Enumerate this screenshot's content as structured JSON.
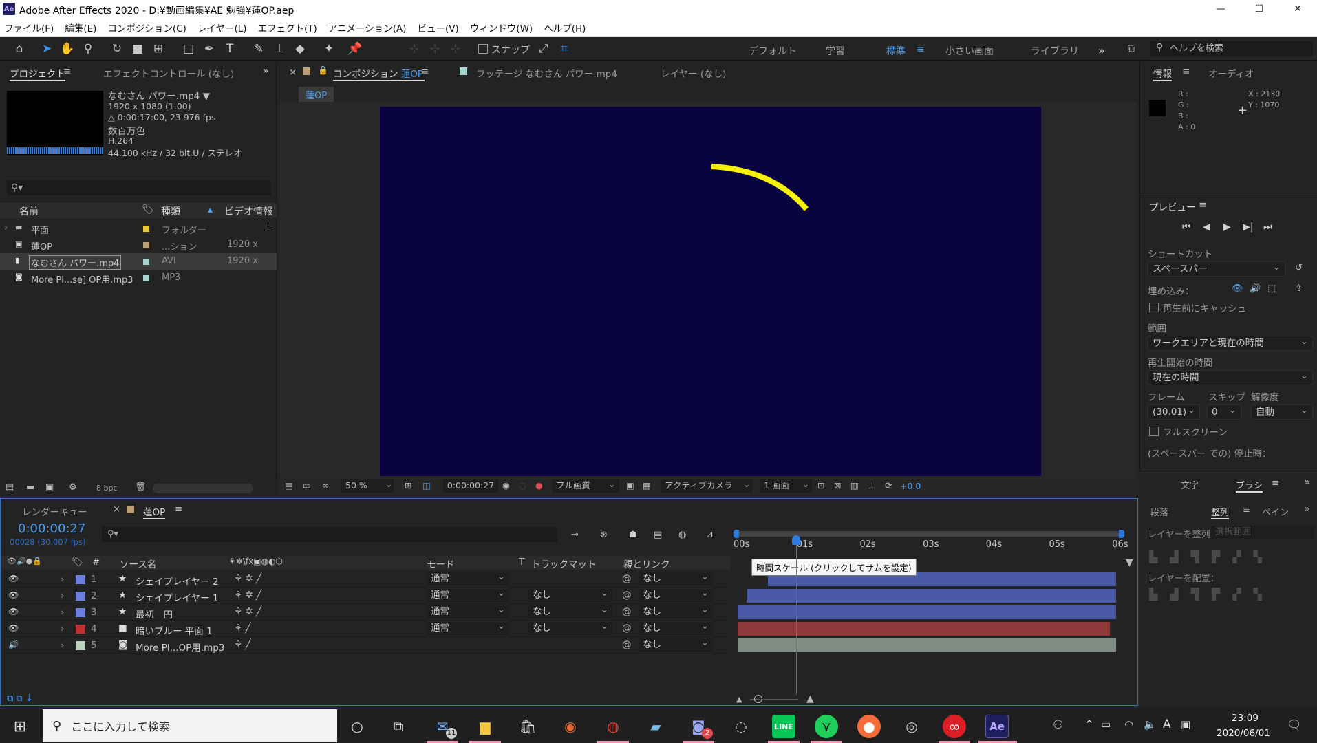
{
  "window": {
    "app_badge": "Ae",
    "title": "Adobe After Effects 2020 - D:¥動画編集¥AE 勉強¥蓮OP.aep",
    "minimize": "—",
    "maximize": "☐",
    "close": "✕"
  },
  "menu": [
    "ファイル(F)",
    "編集(E)",
    "コンポジション(C)",
    "レイヤー(L)",
    "エフェクト(T)",
    "アニメーション(A)",
    "ビュー(V)",
    "ウィンドウ(W)",
    "ヘルプ(H)"
  ],
  "toolbar": {
    "snap_label": "スナップ",
    "workspaces": [
      "デフォルト",
      "学習",
      "標準",
      "小さい画面",
      "ライブラリ"
    ],
    "active_workspace": "標準",
    "help_search_placeholder": "ヘルプを検索",
    "overflow": "»"
  },
  "project": {
    "tab_project": "プロジェクト",
    "tab_effects": "エフェクトコントロール (なし)",
    "file_name": "なむさん パワー.mp4 ▼",
    "file_info": [
      "1920 x 1080 (1.00)",
      "△ 0:00:17:00, 23.976 fps",
      "数百万色",
      "H.264",
      "44.100 kHz / 32 bit U / ステレオ"
    ],
    "search_placeholder": "",
    "columns": {
      "name": "名前",
      "type": "種類",
      "video": "ビデオ情報"
    },
    "items": [
      {
        "name": "平面",
        "type": "フォルダー",
        "video": "",
        "color": "#e8c93a"
      },
      {
        "name": "蓮OP",
        "type": "...ション",
        "video": "1920 x",
        "color": "#bca07a"
      },
      {
        "name": "なむさん パワー.mp4",
        "type": "AVI",
        "video": "1920 x",
        "color": "#a8d4d0"
      },
      {
        "name": "More Pl...se] OP用.mp3",
        "type": "MP3",
        "video": "",
        "color": "#a8d4d0"
      }
    ],
    "bpc": "8 bpc"
  },
  "viewer": {
    "tab_comp_prefix": "コンポジション",
    "tab_comp_name": "蓮OP",
    "tab_footage": "フッテージ なむさん パワー.mp4",
    "tab_layer": "レイヤー (なし)",
    "comp_chip": "蓮OP",
    "zoom": "50 %",
    "timecode": "0:00:00:27",
    "quality": "フル画質",
    "camera": "アクティブカメラ",
    "views": "1 画面",
    "exposure": "+0.0",
    "canvas_color": "#080340",
    "stroke_color": "#f7f300"
  },
  "info": {
    "tab_info": "情報",
    "tab_audio": "オーディオ",
    "rgba": [
      "R :",
      "G :",
      "B :",
      "A : 0"
    ],
    "coords": [
      "X : 2130",
      "Y : 1070"
    ]
  },
  "preview": {
    "title": "プレビュー",
    "shortcut_label": "ショートカット",
    "shortcut_value": "スペースバー",
    "embed_label": "埋め込み：",
    "cache_label": "再生前にキャッシュ",
    "range_label": "範囲",
    "range_value": "ワークエリアと現在の時間",
    "start_label": "再生開始の時間",
    "start_value": "現在の時間",
    "frame_label": "フレーム",
    "skip_label": "スキップ",
    "res_label": "解像度",
    "frame_value": "(30.01)",
    "skip_value": "0",
    "res_value": "自動",
    "fullscreen_label": "フルスクリーン",
    "stop_label": "(スペースバー での) 停止時："
  },
  "side_tabs": {
    "char_tab": "文字",
    "brush_tab": "ブラシ",
    "para_tab": "段落",
    "align_tab": "整列",
    "paint_tab": "ペイン",
    "align_to_label": "レイヤーを整列：",
    "align_to_value": "選択範囲",
    "distribute_label": "レイヤーを配置："
  },
  "timeline": {
    "tab_render": "レンダーキュー",
    "tab_comp": "蓮OP",
    "current_time": "0:00:00:27",
    "frame_info": "00028 (30.007 fps)",
    "columns": {
      "source": "ソース名",
      "mode": "モード",
      "t": "T",
      "matte": "トラックマット",
      "parent": "親とリンク"
    },
    "ruler": [
      "00s",
      "01s",
      "02s",
      "03s",
      "04s",
      "05s",
      "06s"
    ],
    "tooltip": "時間スケール (クリックしてサムを設定)",
    "layers": [
      {
        "num": "1",
        "name": "シェイプレイヤー 2",
        "mode": "通常",
        "matte": "",
        "parent": "なし",
        "label_color": "#6b7fe0",
        "bar_color": "#4b5aa6",
        "start": 0.48,
        "end": 6.0
      },
      {
        "num": "2",
        "name": "シェイプレイヤー 1",
        "mode": "通常",
        "matte": "なし",
        "parent": "なし",
        "label_color": "#6b7fe0",
        "bar_color": "#4b5aa6",
        "start": 0.14,
        "end": 6.0
      },
      {
        "num": "3",
        "name": "最初　円",
        "mode": "通常",
        "matte": "なし",
        "parent": "なし",
        "label_color": "#6b7fe0",
        "bar_color": "#4b5aa6",
        "start": 0.0,
        "end": 6.0
      },
      {
        "num": "4",
        "name": "暗いブルー 平面 1",
        "mode": "通常",
        "matte": "なし",
        "parent": "なし",
        "label_color": "#c03030",
        "bar_color": "#8e3a3a",
        "start": 0.0,
        "end": 5.9
      },
      {
        "num": "5",
        "name": "More Pl...OP用.mp3",
        "mode": "",
        "matte": "",
        "parent": "なし",
        "label_color": "#b9d3bf",
        "bar_color": "#7f8c84",
        "start": 0.0,
        "end": 6.0
      }
    ],
    "playhead_seconds": 0.93
  },
  "taskbar": {
    "search_placeholder": "ここに入力して検索",
    "time": "23:09",
    "date": "2020/06/01",
    "mail_badge": "11",
    "notif_badge": "2"
  }
}
